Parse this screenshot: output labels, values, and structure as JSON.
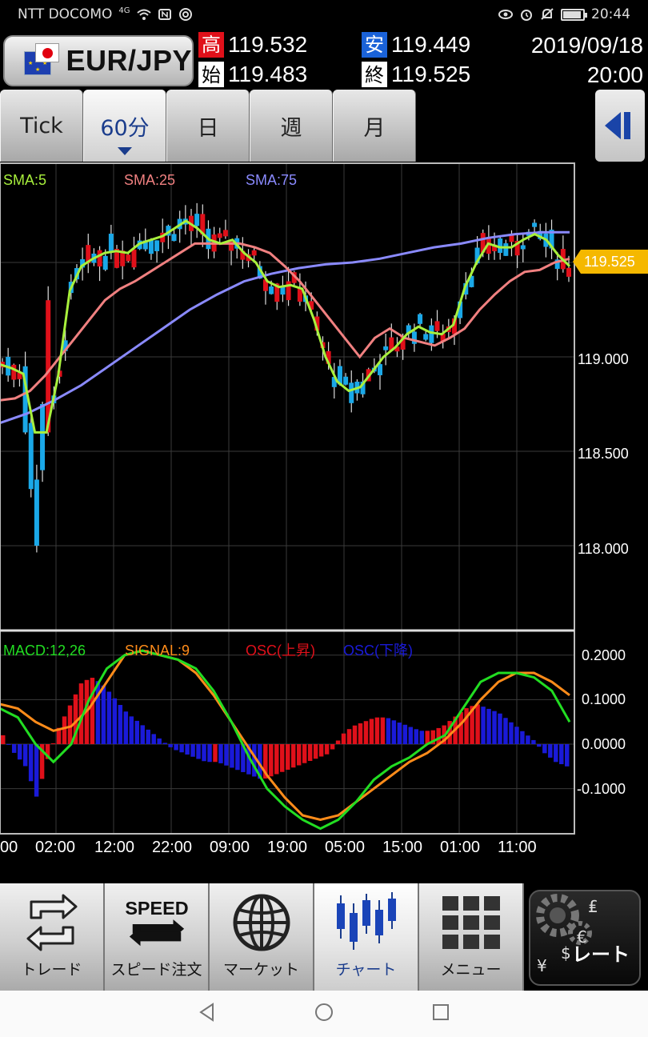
{
  "status": {
    "carrier": "NTT DOCOMO",
    "network": "4G",
    "time": "20:44"
  },
  "header": {
    "pair": "EUR/JPY",
    "quotes": [
      {
        "badge": "高",
        "value": "119.532",
        "color": "#e0101a"
      },
      {
        "badge": "安",
        "value": "119.449",
        "color": "#1a62d8"
      },
      {
        "badge": "始",
        "value": "119.483",
        "color": "#ffffff"
      },
      {
        "badge": "終",
        "value": "119.525",
        "color": "#ffffff"
      }
    ],
    "date": "2019/09/18",
    "time": "20:00"
  },
  "tabs": [
    {
      "label": "Tick",
      "active": false
    },
    {
      "label": "60分",
      "active": true
    },
    {
      "label": "日",
      "active": false
    },
    {
      "label": "週",
      "active": false
    },
    {
      "label": "月",
      "active": false
    }
  ],
  "chart_data": [
    {
      "type": "candlestick",
      "title": "",
      "indicators": [
        {
          "name": "SMA:5",
          "color": "#a8f03c"
        },
        {
          "name": "SMA:25",
          "color": "#f08080"
        },
        {
          "name": "SMA:75",
          "color": "#8a8aff"
        }
      ],
      "y_ticks": [
        "119.000",
        "118.500",
        "118.000"
      ],
      "ylim": [
        117.78,
        119.78
      ],
      "current_price": "119.525",
      "x_ticks": [
        "00",
        "02:00",
        "12:00",
        "22:00",
        "09:00",
        "19:00",
        "05:00",
        "15:00",
        "01:00",
        "11:00"
      ],
      "up_color": "#e0101a",
      "down_color": "#1aa8e8",
      "sma5": [
        118.96,
        118.94,
        118.91,
        118.6,
        118.6,
        118.9,
        119.35,
        119.48,
        119.52,
        119.55,
        119.56,
        119.55,
        119.6,
        119.62,
        119.64,
        119.68,
        119.72,
        119.68,
        119.62,
        119.6,
        119.62,
        119.55,
        119.5,
        119.4,
        119.37,
        119.38,
        119.36,
        119.2,
        119.0,
        118.87,
        118.82,
        118.84,
        118.92,
        119.0,
        119.05,
        119.12,
        119.16,
        119.13,
        119.12,
        119.17,
        119.37,
        119.5,
        119.6,
        119.58,
        119.58,
        119.62,
        119.65,
        119.62,
        119.54,
        119.48
      ],
      "sma25": [
        118.77,
        118.78,
        118.82,
        118.9,
        119.0,
        119.1,
        119.2,
        119.3,
        119.36,
        119.4,
        119.45,
        119.5,
        119.55,
        119.6,
        119.6,
        119.6,
        119.6,
        119.58,
        119.55,
        119.48,
        119.4,
        119.3,
        119.2,
        119.1,
        119.0,
        119.1,
        119.15,
        119.1,
        119.08,
        119.06,
        119.1,
        119.15,
        119.25,
        119.33,
        119.4,
        119.45,
        119.46,
        119.5,
        119.52
      ],
      "sma75": [
        118.65,
        118.7,
        118.77,
        118.85,
        118.95,
        119.05,
        119.15,
        119.25,
        119.33,
        119.4,
        119.44,
        119.47,
        119.49,
        119.5,
        119.52,
        119.55,
        119.58,
        119.6,
        119.63,
        119.65,
        119.66,
        119.66
      ]
    },
    {
      "type": "macd",
      "indicators": [
        {
          "name": "MACD:12,26",
          "color": "#22dd22"
        },
        {
          "name": "SIGNAL:9",
          "color": "#ff8c1a"
        },
        {
          "name": "OSC(上昇)",
          "color": "#e0101a"
        },
        {
          "name": "OSC(下降)",
          "color": "#1a1ad8"
        }
      ],
      "y_ticks": [
        "0.2000",
        "0.1000",
        "0.0000",
        "-0.1000"
      ],
      "ylim": [
        -0.195,
        0.22
      ],
      "osc": [
        0.02,
        -0.02,
        -0.05,
        -0.12,
        -0.03,
        0.04,
        0.09,
        0.14,
        0.15,
        0.13,
        0.1,
        0.07,
        0.05,
        0.03,
        0.01,
        -0.01,
        -0.02,
        -0.03,
        -0.04,
        -0.04,
        -0.05,
        -0.06,
        -0.07,
        -0.08,
        -0.07,
        -0.06,
        -0.05,
        -0.04,
        -0.03,
        -0.02,
        0.02,
        0.04,
        0.05,
        0.06,
        0.06,
        0.05,
        0.04,
        0.03,
        0.03,
        0.04,
        0.06,
        0.08,
        0.09,
        0.08,
        0.07,
        0.05,
        0.03,
        0.01,
        -0.02,
        -0.04,
        -0.05
      ]
    }
  ],
  "nav": [
    {
      "label": "トレード",
      "icon": "trade-arrows-icon"
    },
    {
      "label": "スピード注文",
      "icon": "speed-icon",
      "icon_text": "SPEED"
    },
    {
      "label": "マーケット",
      "icon": "globe-icon"
    },
    {
      "label": "チャート",
      "icon": "candlestick-icon",
      "active": true
    },
    {
      "label": "メニュー",
      "icon": "grid-icon"
    },
    {
      "label": "レート",
      "icon": "currency-gear-icon"
    }
  ]
}
